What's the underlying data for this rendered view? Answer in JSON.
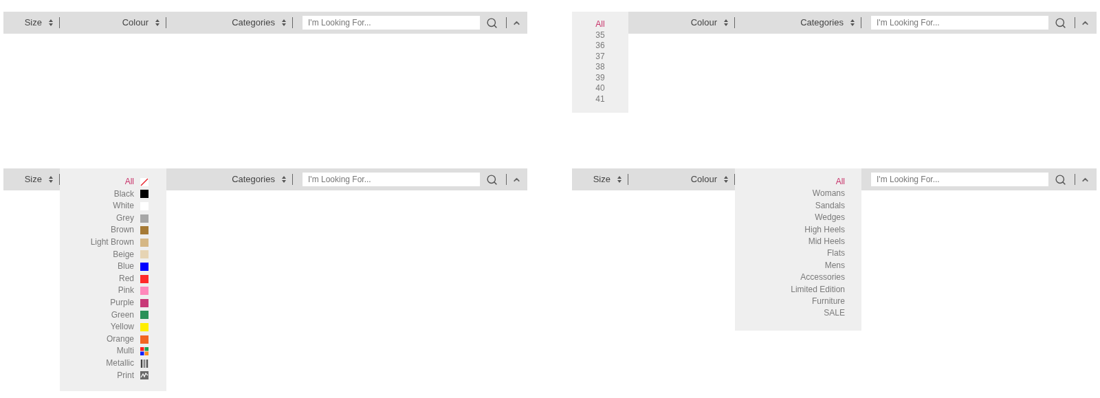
{
  "panels": [
    {
      "filters": [
        {
          "label": "Size",
          "open": false
        },
        {
          "label": "Colour",
          "open": false
        },
        {
          "label": "Categories",
          "open": false
        }
      ],
      "search": {
        "placeholder": "I'm Looking For..."
      }
    },
    {
      "filters": [
        {
          "open": true,
          "options": [
            {
              "label": "All",
              "selected": true
            },
            {
              "label": "35",
              "selected": false
            },
            {
              "label": "36",
              "selected": false
            },
            {
              "label": "37",
              "selected": false
            },
            {
              "label": "38",
              "selected": false
            },
            {
              "label": "39",
              "selected": false
            },
            {
              "label": "40",
              "selected": false
            },
            {
              "label": "41",
              "selected": false
            }
          ]
        },
        {
          "label": "Colour",
          "open": false
        },
        {
          "label": "Categories",
          "open": false
        }
      ],
      "search": {
        "placeholder": "I'm Looking For..."
      }
    },
    {
      "filters": [
        {
          "label": "Size",
          "open": false
        },
        {
          "open": true,
          "options": [
            {
              "label": "All",
              "selected": true,
              "kind": "none"
            },
            {
              "label": "Black",
              "selected": false,
              "kind": "solid",
              "color": "#000000"
            },
            {
              "label": "White",
              "selected": false,
              "kind": "solid",
              "color": "#ffffff"
            },
            {
              "label": "Grey",
              "selected": false,
              "kind": "solid",
              "color": "#a6a6a6"
            },
            {
              "label": "Brown",
              "selected": false,
              "kind": "solid",
              "color": "#a67a35"
            },
            {
              "label": "Light Brown",
              "selected": false,
              "kind": "solid",
              "color": "#d5b785"
            },
            {
              "label": "Beige",
              "selected": false,
              "kind": "solid",
              "color": "#e6d4b4"
            },
            {
              "label": "Blue",
              "selected": false,
              "kind": "solid",
              "color": "#0000ff"
            },
            {
              "label": "Red",
              "selected": false,
              "kind": "solid",
              "color": "#ff2a2a"
            },
            {
              "label": "Pink",
              "selected": false,
              "kind": "solid",
              "color": "#ff88bb"
            },
            {
              "label": "Purple",
              "selected": false,
              "kind": "solid",
              "color": "#c83a78"
            },
            {
              "label": "Green",
              "selected": false,
              "kind": "solid",
              "color": "#2a9058"
            },
            {
              "label": "Yellow",
              "selected": false,
              "kind": "solid",
              "color": "#ffee00"
            },
            {
              "label": "Orange",
              "selected": false,
              "kind": "solid",
              "color": "#f26522"
            },
            {
              "label": "Multi",
              "selected": false,
              "kind": "multi"
            },
            {
              "label": "Metallic",
              "selected": false,
              "kind": "metallic"
            },
            {
              "label": "Print",
              "selected": false,
              "kind": "print"
            }
          ]
        },
        {
          "label": "Categories",
          "open": false
        }
      ],
      "search": {
        "placeholder": "I'm Looking For..."
      }
    },
    {
      "filters": [
        {
          "label": "Size",
          "open": false
        },
        {
          "label": "Colour",
          "open": false
        },
        {
          "open": true,
          "options": [
            {
              "label": "All",
              "selected": true
            },
            {
              "label": "Womans",
              "selected": false
            },
            {
              "label": "Sandals",
              "selected": false
            },
            {
              "label": "Wedges",
              "selected": false
            },
            {
              "label": "High Heels",
              "selected": false
            },
            {
              "label": "Mid Heels",
              "selected": false
            },
            {
              "label": "Flats",
              "selected": false
            },
            {
              "label": "Mens",
              "selected": false
            },
            {
              "label": "Accessories",
              "selected": false
            },
            {
              "label": "Limited Edition",
              "selected": false
            },
            {
              "label": "Furniture",
              "selected": false
            },
            {
              "label": "SALE",
              "selected": false
            }
          ]
        }
      ],
      "search": {
        "placeholder": "I'm Looking For..."
      }
    }
  ]
}
